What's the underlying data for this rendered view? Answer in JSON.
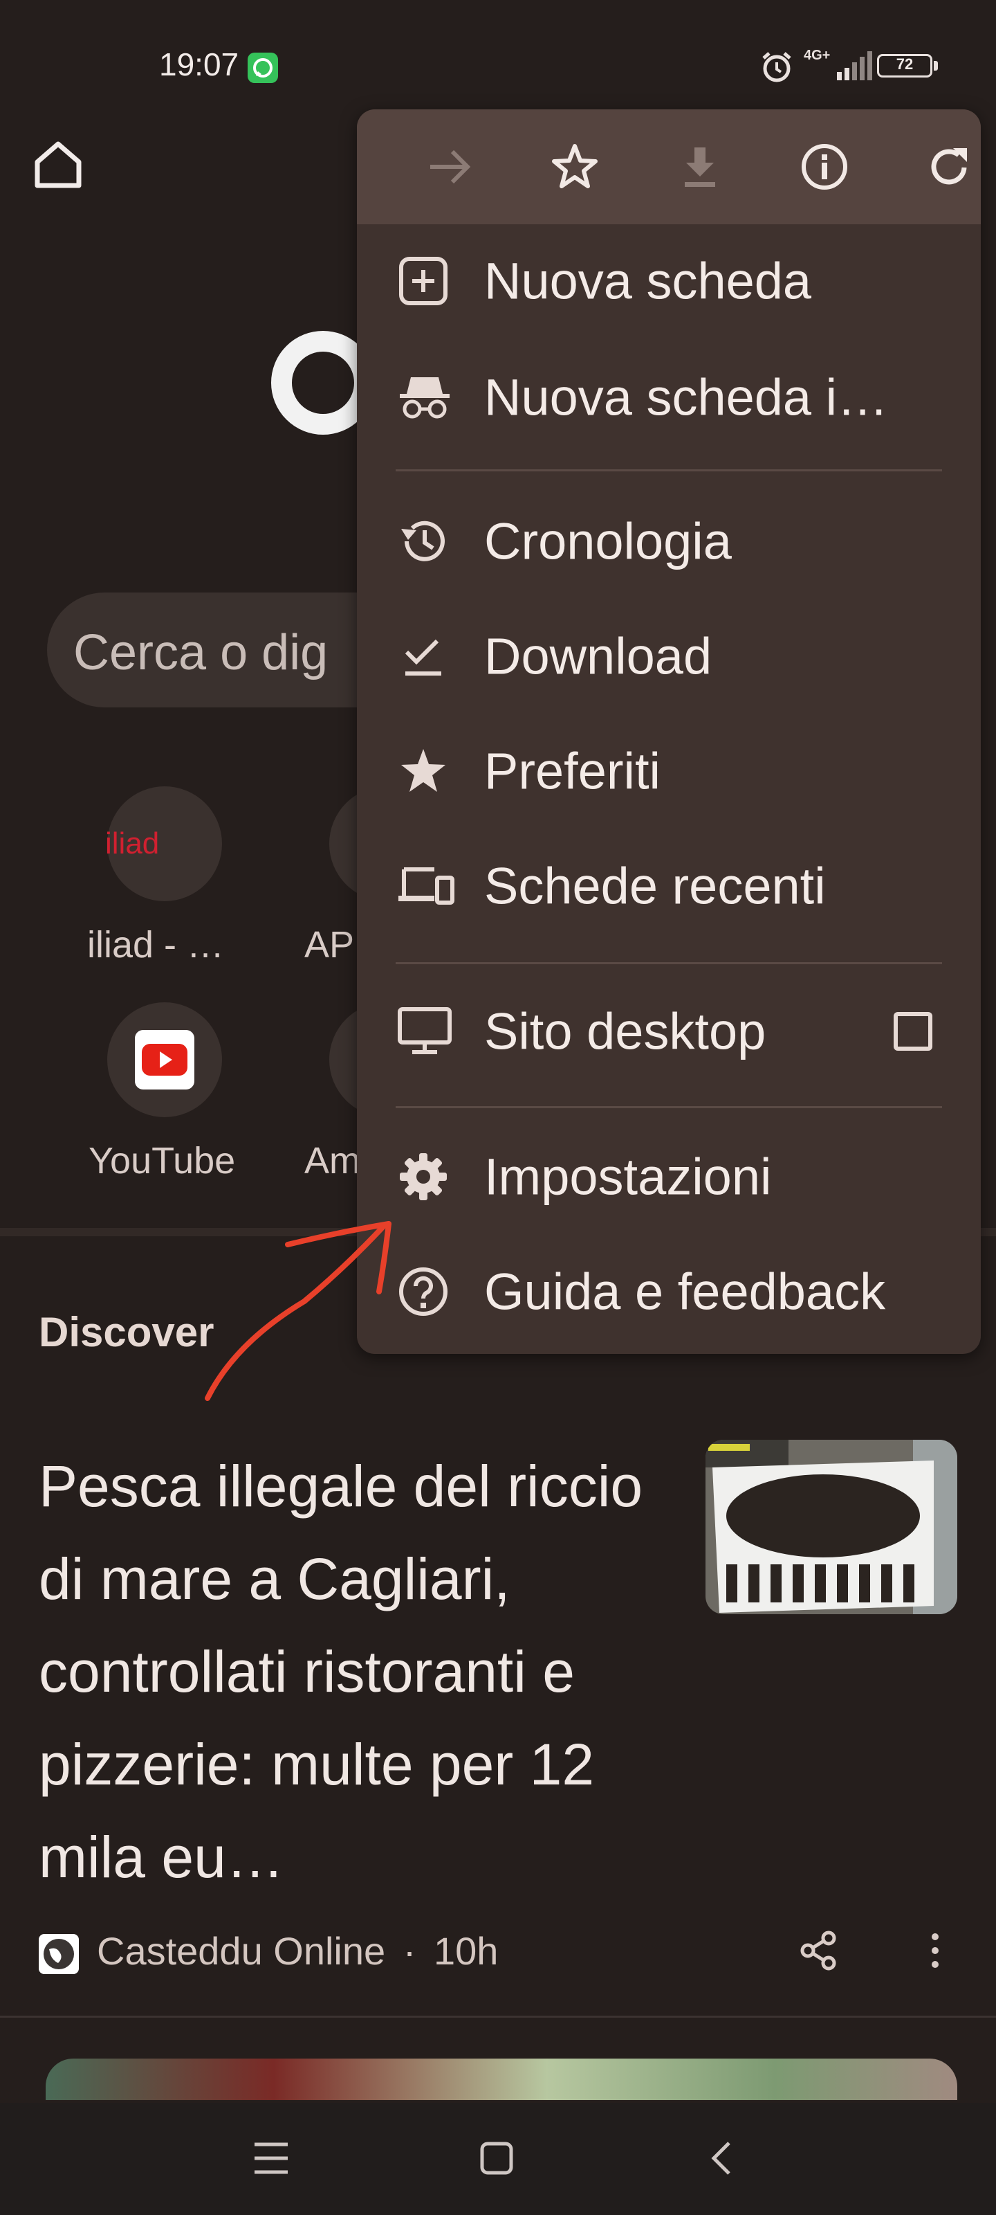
{
  "status_bar": {
    "time": "19:07",
    "network": "4G+",
    "battery": "72"
  },
  "ntp": {
    "search_placeholder": "Cerca o dig",
    "iliad_logo_text": "iliad",
    "shortcuts": [
      {
        "label": "iliad - …"
      },
      {
        "label": "AP"
      },
      {
        "label": "YouTube"
      },
      {
        "label": "Am"
      }
    ]
  },
  "discover": {
    "title": "Discover",
    "article": {
      "headline": "Pesca illegale del riccio di mare a Cagliari, controllati ristoranti e pizzerie: multe per 12 mila eu…",
      "source": "Casteddu Online",
      "time": "10h",
      "separator": "·"
    }
  },
  "menu": {
    "toolbar": [
      {
        "icon": "forward-arrow-icon"
      },
      {
        "icon": "star-outline-icon"
      },
      {
        "icon": "download-icon"
      },
      {
        "icon": "info-icon"
      },
      {
        "icon": "reload-icon"
      }
    ],
    "items": [
      {
        "label": "Nuova scheda",
        "icon": "new-tab-icon"
      },
      {
        "label": "Nuova scheda i…",
        "icon": "incognito-icon"
      },
      {
        "label": "Cronologia",
        "icon": "history-icon"
      },
      {
        "label": "Download",
        "icon": "downloads-check-icon"
      },
      {
        "label": "Preferiti",
        "icon": "star-filled-icon"
      },
      {
        "label": "Schede recenti",
        "icon": "devices-icon"
      },
      {
        "label": "Sito desktop",
        "icon": "monitor-icon",
        "checked": false
      },
      {
        "label": "Impostazioni",
        "icon": "gear-icon"
      },
      {
        "label": "Guida e feedback",
        "icon": "help-icon"
      }
    ]
  },
  "colors": {
    "background": "#251e1c",
    "menu": "#3f322e",
    "menu_toolbar": "#55443f",
    "annotation": "#e8402a"
  }
}
